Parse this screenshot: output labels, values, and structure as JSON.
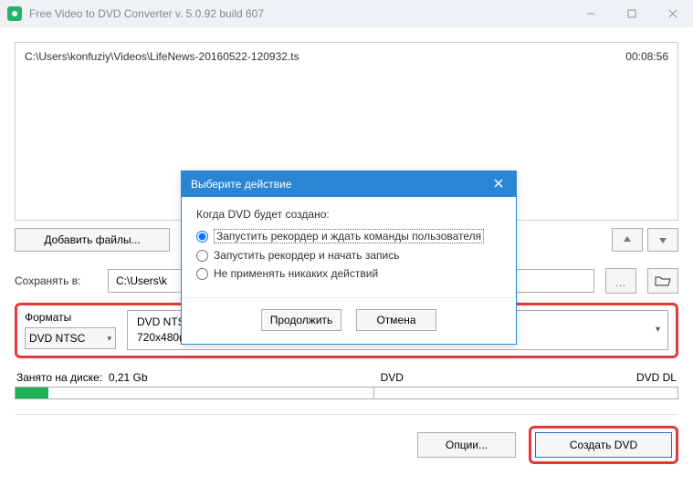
{
  "titlebar": {
    "title": "Free Video to DVD Converter  v. 5.0.92 build 607"
  },
  "file": {
    "path": "C:\\Users\\konfuziy\\Videos\\LifeNews-20160522-120932.ts",
    "duration": "00:08:56"
  },
  "buttons": {
    "add_files": "Добавить файлы...",
    "browse_dots": "...",
    "options": "Опции...",
    "create": "Создать DVD"
  },
  "save": {
    "label": "Сохранять в:",
    "path": "C:\\Users\\k"
  },
  "formats": {
    "label": "Форматы",
    "selected": "DVD NTSC",
    "line1": "DVD NTSC Standard Quality",
    "line2": "720x480(3:2), MPEG2, 3 Mbit; MPEG2, 192 Kbit, 48 kHz"
  },
  "disk": {
    "label": "Занято на диске:",
    "size": "0,21 Gb",
    "mid_label": "DVD",
    "end_label": "DVD DL"
  },
  "modal": {
    "title": "Выберите действие",
    "prompt": "Когда DVD будет создано:",
    "opt1": "Запустить рекордер и ждать команды пользователя",
    "opt2": "Запустить рекордер и начать запись",
    "opt3": "Не применять никаких действий",
    "continue": "Продолжить",
    "cancel": "Отмена"
  }
}
